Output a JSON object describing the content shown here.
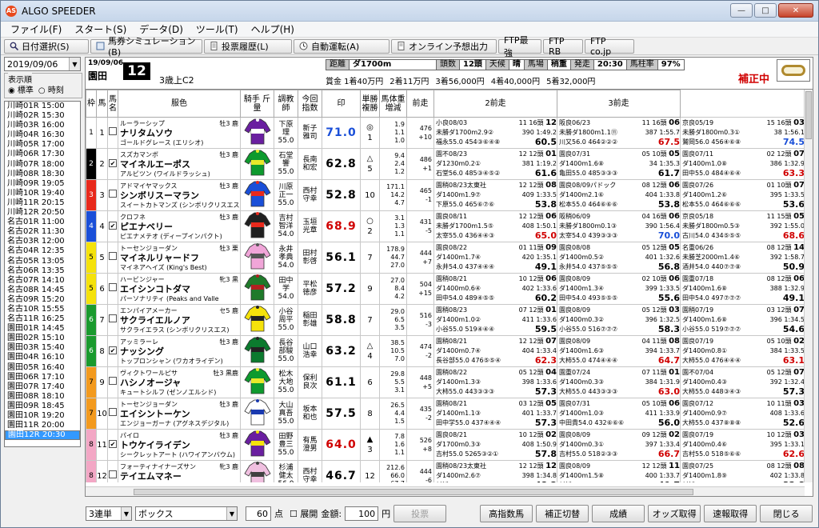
{
  "window": {
    "title": "ALGO SPEEDER"
  },
  "menu": [
    "ファイル(F)",
    "スタート(S)",
    "データ(D)",
    "ツール(T)",
    "ヘルプ(H)"
  ],
  "toolbar": [
    "日付選択(S)",
    "馬券シミュレーション(B)",
    "投票履歴(L)",
    "自動運転(A)",
    "オンライン予想出力",
    "FTP最強",
    "FTP RB",
    "FTP co.jp"
  ],
  "left": {
    "date": "2019/09/06",
    "order_label": "表示順",
    "order_opts": [
      "標準",
      "時刻"
    ],
    "races": [
      "川崎01R 15:00",
      "川崎02R 15:30",
      "川崎03R 16:00",
      "川崎04R 16:30",
      "川崎05R 17:00",
      "川崎06R 17:30",
      "川崎07R 18:00",
      "川崎08R 18:30",
      "川崎09R 19:05",
      "川崎10R 19:40",
      "川崎11R 20:15",
      "川崎12R 20:50",
      "名古01R 11:00",
      "名古02R 11:30",
      "名古03R 12:00",
      "名古04R 12:35",
      "名古05R 13:05",
      "名古06R 13:35",
      "名古07R 14:10",
      "名古08R 14:45",
      "名古09R 15:20",
      "名古10R 15:55",
      "名古11R 16:25",
      "園田01R 14:45",
      "園田02R 15:10",
      "園田03R 15:40",
      "園田04R 16:10",
      "園田05R 16:40",
      "園田06R 17:10",
      "園田07R 17:40",
      "園田08R 18:10",
      "園田09R 18:45",
      "園田10R 19:20",
      "園田11R 20:00",
      "園田12R 20:30"
    ],
    "selected_race": "園田12R 20:30"
  },
  "race": {
    "date": "19/09/06",
    "track": "園田",
    "num": "12",
    "cls": "3歳上C2",
    "hosei": "補正中",
    "cond": [
      [
        "距離",
        "ダ1700m"
      ],
      [
        "頭数",
        "12頭"
      ],
      [
        "天候",
        "晴"
      ],
      [
        "馬場",
        "稍重"
      ],
      [
        "発走",
        "20:30"
      ],
      [
        "馬柱率",
        "97%"
      ]
    ],
    "prize": [
      "賞金 1着40万円",
      "2着11万円",
      "3着56,000円",
      "4着40,000円",
      "5着32,000円"
    ]
  },
  "headers": [
    "枠",
    "馬",
    "馬　　名",
    "服色",
    "騎手 斤量",
    "調教師",
    "今回指数",
    "印",
    "単勝 複勝",
    "馬体重 増減",
    "前走",
    "2前走",
    "3前走"
  ],
  "horses": [
    {
      "waku": "1",
      "num": "1",
      "chk": "",
      "sire": "ルーラーシップ",
      "sex": "牡3",
      "col": "鹿",
      "name": "ナリタムソウ",
      "dam": "ゴールドグレース (エリシオ)",
      "jockey": "下原 理",
      "kin": "55.0",
      "trainer": "新子 雅司",
      "idx": "71.0",
      "mark": "◎",
      "pop": "1",
      "odds1": "1.9",
      "odds2": "1.1",
      "odds3": "1.0",
      "wt": "476",
      "wd": "+10",
      "p": [
        [
          "小良08/03",
          "11 16頭",
          "12",
          "未勝ダ1700m2.9②",
          "390 1:49.2",
          "福永55.0 454③⑥④⑧",
          "60.5"
        ],
        [
          "阪良06/23",
          "11 16頭",
          "06",
          "未勝ダ1800m1.1⑪",
          "387 1:55.7",
          "川又56.0 464②②②",
          "67.5"
        ],
        [
          "京良05/19",
          "15 16頭",
          "03",
          "未勝ダ1800m0.3①",
          "38 1:56.1",
          "鷲岡56.0 456④⑥⑧",
          "74.5"
        ]
      ]
    },
    {
      "waku": "2",
      "num": "2",
      "chk": "✔",
      "sire": "スズカマンボ",
      "sex": "牡3",
      "col": "鹿",
      "name": "マイネルエーポス",
      "dam": "アルビツン (ワイルドラッシュ)",
      "jockey": "石堂 響",
      "kin": "55.0",
      "trainer": "長南 和宏",
      "idx": "62.8",
      "mark": "△",
      "pop": "5",
      "odds1": "9.4",
      "odds2": "2.4",
      "odds3": "1.2",
      "wt": "486",
      "wd": "+1",
      "p": [
        [
          "園不08/23",
          "12 12頭",
          "01",
          "ダ1230m0.2①",
          "381 1:19.2",
          "石堂56.0 485③④⑤②",
          "61.6"
        ],
        [
          "園良07/31",
          "05 10頭",
          "05",
          "ダ1400m1.6⑧",
          "34 1:35.3",
          "亀田55.0 485③③③",
          "61.7"
        ],
        [
          "園良07/11",
          "02 12頭",
          "07",
          "ダ1400m1.0⑧",
          "386 1:32.9",
          "田中55.0 484④⑥④",
          "63.3"
        ]
      ]
    },
    {
      "waku": "3",
      "num": "3",
      "chk": "",
      "sire": "アドマイヤマックス",
      "sex": "牡3",
      "col": "鹿",
      "name": "シンボリスーマラン",
      "dam": "スイートカトマンズ (シンボリクリスエス)",
      "jockey": "川原 正一",
      "kin": "55.0",
      "trainer": "西村 守幸",
      "idx": "52.8",
      "mark": "",
      "pop": "10",
      "odds1": "171.1",
      "odds2": "14.2",
      "odds3": "4.7",
      "wt": "465",
      "wd": "-1",
      "p": [
        [
          "園稍08/23太東社",
          "12 12頭",
          "08",
          "ダ1400m1.9⑦",
          "409 1:33.5",
          "下原55.0 465⑥⑦⑥",
          "53.8"
        ],
        [
          "園良08/09パドック",
          "08 12頭",
          "06",
          "ダ1400m2.1⑥",
          "404 1:33.8",
          "松本55.0 464⑥⑥⑥",
          "53.8"
        ],
        [
          "園良07/26",
          "01 10頭",
          "07",
          "ダ1400m1.2⑥",
          "395 1:33.5",
          "松本55.0 464⑥⑥⑥",
          "53.6"
        ]
      ]
    },
    {
      "waku": "4",
      "num": "4",
      "chk": "✔",
      "sire": "クロフネ",
      "sex": "牡3",
      "col": "鹿",
      "name": "ピエナベリー",
      "dam": "ピエナメテオ (ディープインパクト)",
      "jockey": "吉村 智洋",
      "kin": "54.0",
      "trainer": "玉垣 光章",
      "idx": "68.9",
      "mark": "○",
      "pop": "2",
      "odds1": "3.1",
      "odds2": "1.3",
      "odds3": "1.1",
      "wt": "431",
      "wd": "-5",
      "p": [
        [
          "園良08/11",
          "12 12頭",
          "06",
          "未勝ダ1700m1.5⑤",
          "408 1:50.1",
          "太宰55.0 436④④③",
          "65.0"
        ],
        [
          "阪稍06/09",
          "04 16頭",
          "06",
          "未勝ダ1800m0.1③",
          "390 1:56.4",
          "太宰54.0 439③③③",
          "70.0"
        ],
        [
          "京良05/18",
          "11 15頭",
          "05",
          "未勝ダ1800m0.5③",
          "392 1:55.0",
          "古川54.0 434⑤⑤⑤",
          "68.6"
        ]
      ]
    },
    {
      "waku": "5",
      "num": "5",
      "chk": "",
      "sire": "トーセンジョーダン",
      "sex": "牡3",
      "col": "栗",
      "name": "マイネルリャードフ",
      "dam": "マイネアヘイズ (King's Best)",
      "jockey": "永井 孝典",
      "kin": "54.0",
      "trainer": "田村 彰啓",
      "idx": "56.1",
      "mark": "",
      "pop": "7",
      "odds1": "178.9",
      "odds2": "44.7",
      "odds3": "27.0",
      "wt": "444",
      "wd": "+7",
      "p": [
        [
          "園良08/22",
          "01 11頭",
          "09",
          "ダ1400m1.7④",
          "420 1:35.1",
          "永井54.0 437④④④",
          "49.1"
        ],
        [
          "園良08/08",
          "05 12頭",
          "05",
          "ダ1400m0.5②",
          "401 1:32.6",
          "永井54.0 437⑤⑤⑤",
          "56.8"
        ],
        [
          "名重06/26",
          "08 12頭",
          "14",
          "未勝芝2000m1.4⑥",
          "392 1:58.7",
          "酒井54.0 440⑦⑦⑧",
          "50.9"
        ]
      ]
    },
    {
      "waku": "5",
      "num": "6",
      "chk": "",
      "sire": "ハービンジャー",
      "sex": "牝3",
      "col": "黒",
      "name": "エイシンコトダマ",
      "dam": "パーソナリティ (Peaks and Valle",
      "jockey": "田中 学",
      "kin": "54.0",
      "trainer": "平松 徳彦",
      "idx": "57.2",
      "mark": "",
      "pop": "9",
      "odds1": "27.0",
      "odds2": "8.4",
      "odds3": "4.2",
      "wt": "504",
      "wd": "+15",
      "p": [
        [
          "園稍08/21",
          "10 12頭",
          "06",
          "ダ1400m0.6④",
          "402 1:33.6",
          "田中54.0 489④⑤⑤",
          "60.2"
        ],
        [
          "園良08/09",
          "02 10頭",
          "06",
          "ダ1400m1.3④",
          "399 1:33.5",
          "田中54.0 493⑤⑤⑤",
          "55.6"
        ],
        [
          "園重07/18",
          "08 12頭",
          "06",
          "ダ1400m1.6⑧",
          "388 1:32.9",
          "田中54.0 497⑦⑦⑦",
          "49.1"
        ]
      ]
    },
    {
      "waku": "6",
      "num": "7",
      "chk": "",
      "sire": "エンパイアメーカー",
      "sex": "セ5",
      "col": "鹿",
      "name": "サクライエルノア",
      "dam": "サクライエラス (シンボリクリスエス)",
      "jockey": "小谷 周平",
      "kin": "55.0",
      "trainer": "稲田 彰雄",
      "idx": "58.8",
      "mark": "",
      "pop": "7",
      "odds1": "29.0",
      "odds2": "6.5",
      "odds3": "3.5",
      "wt": "516",
      "wd": "-3",
      "p": [
        [
          "園稍08/23",
          "07 12頭",
          "01",
          "ダ1400m1.0②",
          "411 1:33.6",
          "小谷55.0 519④④④",
          "59.5"
        ],
        [
          "園良08/09",
          "05 12頭",
          "03",
          "ダ1400m0.3②",
          "396 1:32.5",
          "小谷55.0 516⑦⑦⑦",
          "58.3"
        ],
        [
          "園稍07/19",
          "03 12頭",
          "07",
          "ダ1400m1.6⑧",
          "396 1:34.5",
          "小谷55.0 519⑦⑦⑦",
          "54.6"
        ]
      ]
    },
    {
      "waku": "6",
      "num": "8",
      "chk": "✔",
      "sire": "アッミラーレ",
      "sex": "牡3",
      "col": "鹿",
      "name": "ナッシング",
      "dam": "トップロンシャン (ワカオライデン)",
      "jockey": "長谷 部駿",
      "kin": "55.0",
      "trainer": "山口 浩幸",
      "idx": "63.2",
      "mark": "△",
      "pop": "4",
      "odds1": "38.5",
      "odds2": "10.5",
      "odds3": "7.0",
      "wt": "474",
      "wd": "-2",
      "p": [
        [
          "園稍08/21",
          "12 12頭",
          "07",
          "ダ1400m0.7④",
          "404 1:33.4",
          "長谷部55.0 476⑤⑤④",
          "62.3"
        ],
        [
          "園良08/09",
          "04 11頭",
          "08",
          "ダ1400m1.6③",
          "394 1:33.7",
          "大柿55.0 474④④④",
          "64.7"
        ],
        [
          "園良07/19",
          "05 10頭",
          "02",
          "ダ1400m0.8①",
          "384 1:33.5",
          "大柿55.0 476④④④",
          "63.1"
        ]
      ]
    },
    {
      "waku": "7",
      "num": "9",
      "chk": "",
      "sire": "ヴィクトワールピサ",
      "sex": "牡3",
      "col": "黒鹿",
      "name": "ハシノオージャ",
      "dam": "キュートシルフ (ゼンノエルシド)",
      "jockey": "松木 大地",
      "kin": "55.0",
      "trainer": "保利 良次",
      "idx": "61.1",
      "mark": "",
      "pop": "6",
      "odds1": "29.8",
      "odds2": "5.5",
      "odds3": "3.1",
      "wt": "448",
      "wd": "+5",
      "p": [
        [
          "園稍08/22",
          "05 12頭",
          "04",
          "ダ1400m1.3③",
          "398 1:33.6",
          "大柿55.0 443③③③",
          "57.3"
        ],
        [
          "園重07/24",
          "07 11頭",
          "01",
          "ダ1400m0.3③",
          "384 1:31.9",
          "大柿55.0 443③③③",
          "63.0"
        ],
        [
          "園不07/04",
          "05 12頭",
          "07",
          "ダ1400m0.4③",
          "392 1:32.4",
          "大柿55.0 448③④③",
          "57.3"
        ]
      ]
    },
    {
      "waku": "7",
      "num": "10",
      "chk": "",
      "sire": "トーセンジョーダン",
      "sex": "牡3",
      "col": "鹿",
      "name": "エイシントーケン",
      "dam": "エンジョーガーナ (アグネスデジタル)",
      "jockey": "大山 真吾",
      "kin": "55.0",
      "trainer": "坂本 和也",
      "idx": "57.5",
      "mark": "",
      "pop": "8",
      "odds1": "26.5",
      "odds2": "4.4",
      "odds3": "1.5",
      "wt": "435",
      "wd": "-2",
      "p": [
        [
          "園稍08/21",
          "03 12頭",
          "05",
          "ダ1400m1.1③",
          "401 1:33.7",
          "田中学55.0 437④④④",
          "57.3"
        ],
        [
          "園良07/31",
          "05 10頭",
          "06",
          "ダ1400m1.0③",
          "411 1:33.9",
          "中田貴54.0 432⑥⑥⑥",
          "56.0"
        ],
        [
          "園良07/12",
          "10 11頭",
          "03",
          "ダ1400m0.9⑦",
          "408 1:33.6",
          "大柿55.0 437⑧⑧⑧",
          "52.6"
        ]
      ]
    },
    {
      "waku": "8",
      "num": "11",
      "chk": "✔",
      "sire": "パイロ",
      "sex": "牡3",
      "col": "鹿",
      "name": "トウケイライデン",
      "dam": "シークレットアート (ハワイアンバウム)",
      "jockey": "田野 豊三",
      "kin": "55.0",
      "trainer": "有馬 澄男",
      "idx": "64.0",
      "mark": "▲",
      "pop": "3",
      "odds1": "7.8",
      "odds2": "1.6",
      "odds3": "1.1",
      "wt": "526",
      "wd": "+8",
      "p": [
        [
          "園良08/21",
          "10 12頭",
          "02",
          "ダ1700m0.3③",
          "408 1:50.9",
          "吉村55.0 5265③②①",
          "57.8"
        ],
        [
          "園良08/09",
          "09 12頭",
          "02",
          "ダ1400m0.3①",
          "397 1:33.4",
          "吉村55.0 518②③③",
          "66.7"
        ],
        [
          "園良07/19",
          "10 12頭",
          "03",
          "ダ1400m0.4⑥",
          "395 1:33.1",
          "吉村55.0 518⑤⑥⑥",
          "62.6"
        ]
      ]
    },
    {
      "waku": "8",
      "num": "12",
      "chk": "",
      "sire": "フォーティナイナーズサン",
      "sex": "牝3",
      "col": "鹿",
      "name": "テイエムマネー",
      "dam": "エンジェルステージ (タニノギムレット)",
      "jockey": "杉浦 健太",
      "kin": "56.0",
      "trainer": "西村 守幸",
      "idx": "46.7",
      "mark": "",
      "pop": "12",
      "odds1": "212.6",
      "odds2": "66.0",
      "odds3": "67.7",
      "wt": "444",
      "wd": "-6",
      "p": [
        [
          "園稍08/23太東社",
          "12 12頭",
          "12",
          "ダ1400m2.6⑦",
          "398 1:34.8",
          "杉浦56.0 448⑨⑨⑨",
          "48.3"
        ],
        [
          "園良08/09",
          "12 12頭",
          "11",
          "ダ1400m1.5⑧",
          "400 1:33.7",
          "杉浦56.0 450⑧⑧⑧",
          "49.7"
        ],
        [
          "園良07/25",
          "08 12頭",
          "08",
          "ダ1400m1.8⑨",
          "402 1:33.8",
          "杉浦56.0 450⑧⑧⑧",
          "32.8"
        ]
      ]
    }
  ],
  "bottom": {
    "bet": "3連単",
    "mode": "ボックス",
    "pts": "60",
    "pts_unit": "点",
    "expand": "展開",
    "amount_label": "金額:",
    "amount": "100",
    "yen": "円",
    "vote": "投票",
    "btns": [
      "高指数馬",
      "補正切替",
      "成績",
      "オッズ取得",
      "速報取得",
      "閉じる"
    ]
  },
  "colors": {
    "waku": [
      "#ffffff",
      "#000000",
      "#e8291c",
      "#1a4fd8",
      "#f5e20b",
      "#1a9a2e",
      "#f39a1e",
      "#f3a7c5"
    ],
    "accent": "#3399ff",
    "red": "#d00000",
    "blue": "#1a4fd8"
  }
}
